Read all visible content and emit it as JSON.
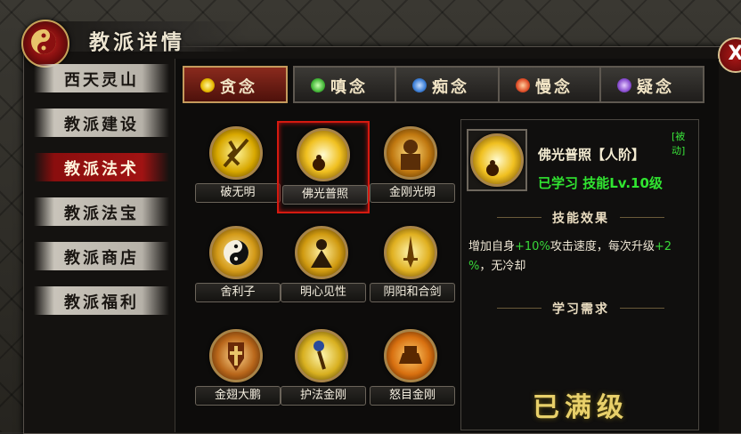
{
  "window": {
    "title": "教派详情",
    "close_label": "X"
  },
  "sidebar": {
    "items": [
      {
        "label": "西天灵山",
        "active": false
      },
      {
        "label": "教派建设",
        "active": false
      },
      {
        "label": "教派法术",
        "active": true
      },
      {
        "label": "教派法宝",
        "active": false
      },
      {
        "label": "教派商店",
        "active": false
      },
      {
        "label": "教派福利",
        "active": false
      }
    ]
  },
  "tabs": [
    {
      "label": "贪念",
      "active": true,
      "icon_color": "#e6b800",
      "icon": "greed-orb-icon"
    },
    {
      "label": "嗔念",
      "active": false,
      "icon_color": "#46b83a",
      "icon": "anger-orb-icon"
    },
    {
      "label": "痴念",
      "active": false,
      "icon_color": "#3d7fd6",
      "icon": "delusion-orb-icon"
    },
    {
      "label": "慢念",
      "active": false,
      "icon_color": "#e0502a",
      "icon": "pride-orb-icon"
    },
    {
      "label": "疑念",
      "active": false,
      "icon_color": "#8a4fd0",
      "icon": "doubt-orb-icon"
    }
  ],
  "skills": [
    {
      "label": "破无明",
      "selected": false,
      "icon": "sword-lightning-icon"
    },
    {
      "label": "佛光普照",
      "selected": true,
      "icon": "buddha-light-icon"
    },
    {
      "label": "金刚光明",
      "selected": false,
      "icon": "vajra-warrior-icon"
    },
    {
      "label": "舍利子",
      "selected": false,
      "icon": "yin-yang-icon"
    },
    {
      "label": "明心见性",
      "selected": false,
      "icon": "meditating-monk-icon"
    },
    {
      "label": "阴阳和合剑",
      "selected": false,
      "icon": "golden-sword-icon"
    },
    {
      "label": "金翅大鹏",
      "selected": false,
      "icon": "golden-wing-shield-icon"
    },
    {
      "label": "护法金刚",
      "selected": false,
      "icon": "guardian-staff-icon"
    },
    {
      "label": "怒目金刚",
      "selected": false,
      "icon": "fire-pagoda-icon"
    }
  ],
  "detail": {
    "passive_tag": "[被动]",
    "skill_name": "佛光普照【人阶】",
    "learn_status": "已学习 技能Lv.10级",
    "effect_heading": "技能效果",
    "effect_parts": [
      {
        "text": "增加自身",
        "highlight": false
      },
      {
        "text": "+10%",
        "highlight": true
      },
      {
        "text": "攻击速度，每次升级",
        "highlight": false
      },
      {
        "text": "+2",
        "highlight": true
      },
      {
        "text": "%",
        "highlight": true
      },
      {
        "text": "，无冷却",
        "highlight": false
      }
    ],
    "requirement_heading": "学习需求",
    "maxed_label": "已满级"
  },
  "colors": {
    "accent_red": "#a11313",
    "selection_red": "#d51a10",
    "highlight_green": "#38d838",
    "gold": "#e8d06a"
  }
}
